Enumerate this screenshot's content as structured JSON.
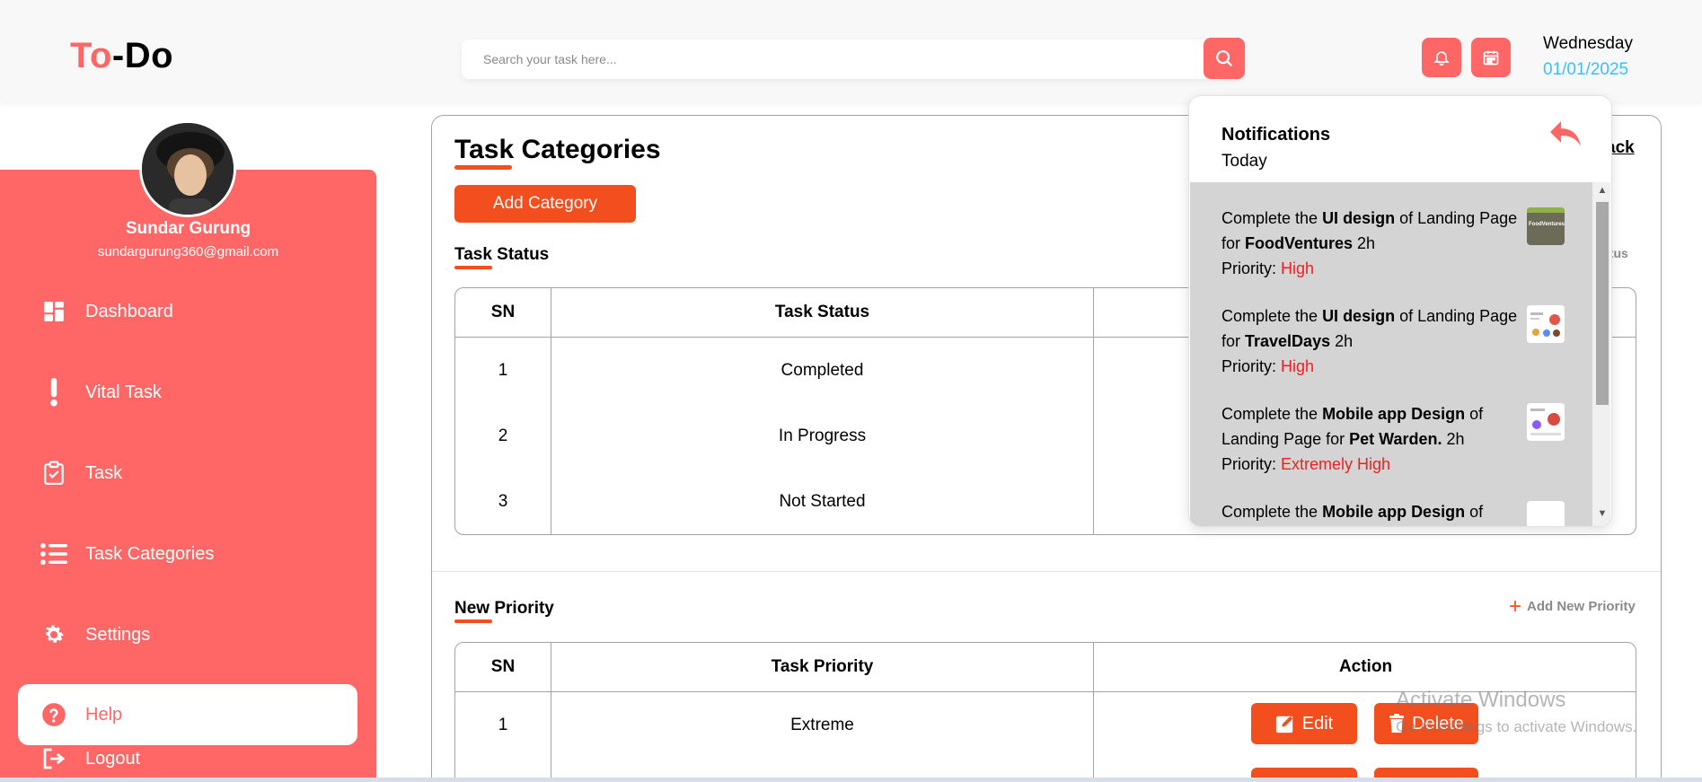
{
  "header": {
    "logo_part1": "To",
    "logo_part2": "-Do",
    "search_placeholder": "Search your task here...",
    "day": "Wednesday",
    "date": "01/01/2025"
  },
  "user": {
    "name": "Sundar Gurung",
    "email": "sundargurung360@gmail.com"
  },
  "sidebar": {
    "items": [
      {
        "label": "Dashboard",
        "icon": "dashboard-icon"
      },
      {
        "label": "Vital Task",
        "icon": "exclamation-icon"
      },
      {
        "label": "Task",
        "icon": "clipboard-check-icon"
      },
      {
        "label": "Task Categories",
        "icon": "list-icon"
      },
      {
        "label": "Settings",
        "icon": "gear-icon"
      },
      {
        "label": "Help",
        "icon": "help-icon"
      },
      {
        "label": "Logout",
        "icon": "logout-icon"
      }
    ],
    "active_index": 5
  },
  "main": {
    "title": "Task Categories",
    "add_category_label": "Add Category",
    "go_back_label": "ack",
    "task_status": {
      "title": "Task Status",
      "add_link": "atus",
      "headers": [
        "SN",
        "Task Status",
        ""
      ],
      "rows": [
        {
          "sn": "1",
          "value": "Completed"
        },
        {
          "sn": "2",
          "value": "In Progress"
        },
        {
          "sn": "3",
          "value": "Not Started"
        }
      ]
    },
    "priority": {
      "title": "New Priority",
      "add_link": "Add New Priority",
      "headers": [
        "SN",
        "Task Priority",
        "Action"
      ],
      "rows": [
        {
          "sn": "1",
          "value": "Extreme",
          "edit": "Edit",
          "delete": "Delete"
        }
      ]
    }
  },
  "notifications": {
    "title": "Notifications",
    "subtitle": "Today",
    "priority_label": "Priority:",
    "items": [
      {
        "pre": "Complete the ",
        "b1": "UI design",
        "mid": " of Landing Page for ",
        "b2": "FoodVentures",
        "post": " 2h",
        "priority": "High"
      },
      {
        "pre": "Complete the ",
        "b1": "UI design",
        "mid": " of Landing Page for ",
        "b2": "TravelDays",
        "post": " 2h",
        "priority": "High"
      },
      {
        "pre": "Complete the ",
        "b1": "Mobile app Design",
        "mid": " of Landing Page for ",
        "b2": "Pet Warden.",
        "post": " 2h",
        "priority": "Extremely High"
      },
      {
        "pre": "Complete the ",
        "b1": "Mobile app Design",
        "mid": " of",
        "b2": "",
        "post": "",
        "priority": ""
      }
    ],
    "thumb_text": "FoodVentures"
  },
  "watermark": {
    "title": "Activate Windows",
    "subtitle": "Go to Settings to activate Windows."
  },
  "colors": {
    "brand": "#ff6767",
    "accent": "#f24e1e",
    "date": "#3abeff",
    "priority": "#f21e1e"
  }
}
